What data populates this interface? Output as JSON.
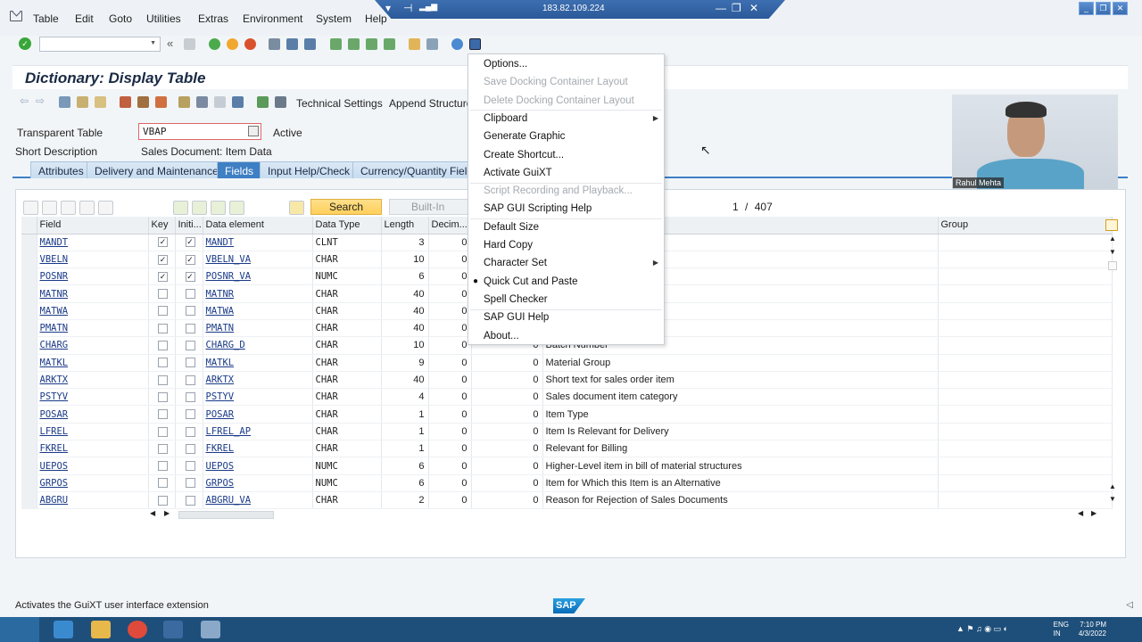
{
  "menubar": {
    "items": [
      "Table",
      "Edit",
      "Goto",
      "Utilities",
      "Extras",
      "Environment",
      "System",
      "Help"
    ],
    "remote_ip": "183.82.109.224"
  },
  "title": "Dictionary: Display Table",
  "app_toolbar": {
    "technical_settings": "Technical Settings",
    "append_structure": "Append Structure"
  },
  "header": {
    "transparent_table_label": "Transparent Table",
    "table_name": "VBAP",
    "status": "Active",
    "short_desc_label": "Short Description",
    "short_desc_value": "Sales Document: Item Data"
  },
  "tabs": [
    "Attributes",
    "Delivery and Maintenance",
    "Fields",
    "Input Help/Check",
    "Currency/Quantity Fields"
  ],
  "grid": {
    "search_label": "Search",
    "builtin_label": "Built-In Type",
    "page_current": "1",
    "page_sep": "/",
    "page_total": "407",
    "columns": [
      "Field",
      "Key",
      "Initi...",
      "Data element",
      "Data Type",
      "Length",
      "Decim...",
      "",
      "",
      "Group"
    ],
    "rows": [
      {
        "field": "MANDT",
        "key": true,
        "init": true,
        "elem": "MANDT",
        "type": "CLNT",
        "len": "3",
        "dec": "0",
        "coord": "",
        "desc": ""
      },
      {
        "field": "VBELN",
        "key": true,
        "init": true,
        "elem": "VBELN_VA",
        "type": "CHAR",
        "len": "10",
        "dec": "0",
        "coord": "",
        "desc": ""
      },
      {
        "field": "POSNR",
        "key": true,
        "init": true,
        "elem": "POSNR_VA",
        "type": "NUMC",
        "len": "6",
        "dec": "0",
        "coord": "",
        "desc": ""
      },
      {
        "field": "MATNR",
        "key": false,
        "init": false,
        "elem": "MATNR",
        "type": "CHAR",
        "len": "40",
        "dec": "0",
        "coord": "",
        "desc": ""
      },
      {
        "field": "MATWA",
        "key": false,
        "init": false,
        "elem": "MATWA",
        "type": "CHAR",
        "len": "40",
        "dec": "0",
        "coord": "",
        "desc": ""
      },
      {
        "field": "PMATN",
        "key": false,
        "init": false,
        "elem": "PMATN",
        "type": "CHAR",
        "len": "40",
        "dec": "0",
        "coord": "",
        "desc": ""
      },
      {
        "field": "CHARG",
        "key": false,
        "init": false,
        "elem": "CHARG_D",
        "type": "CHAR",
        "len": "10",
        "dec": "0",
        "coord": "0",
        "desc": "Batch Number"
      },
      {
        "field": "MATKL",
        "key": false,
        "init": false,
        "elem": "MATKL",
        "type": "CHAR",
        "len": "9",
        "dec": "0",
        "coord": "0",
        "desc": "Material Group"
      },
      {
        "field": "ARKTX",
        "key": false,
        "init": false,
        "elem": "ARKTX",
        "type": "CHAR",
        "len": "40",
        "dec": "0",
        "coord": "0",
        "desc": "Short text for sales order item"
      },
      {
        "field": "PSTYV",
        "key": false,
        "init": false,
        "elem": "PSTYV",
        "type": "CHAR",
        "len": "4",
        "dec": "0",
        "coord": "0",
        "desc": "Sales document item category"
      },
      {
        "field": "POSAR",
        "key": false,
        "init": false,
        "elem": "POSAR",
        "type": "CHAR",
        "len": "1",
        "dec": "0",
        "coord": "0",
        "desc": "Item Type"
      },
      {
        "field": "LFREL",
        "key": false,
        "init": false,
        "elem": "LFREL_AP",
        "type": "CHAR",
        "len": "1",
        "dec": "0",
        "coord": "0",
        "desc": "Item Is Relevant for Delivery"
      },
      {
        "field": "FKREL",
        "key": false,
        "init": false,
        "elem": "FKREL",
        "type": "CHAR",
        "len": "1",
        "dec": "0",
        "coord": "0",
        "desc": "Relevant for Billing"
      },
      {
        "field": "UEPOS",
        "key": false,
        "init": false,
        "elem": "UEPOS",
        "type": "NUMC",
        "len": "6",
        "dec": "0",
        "coord": "0",
        "desc": "Higher-Level item in bill of material structures"
      },
      {
        "field": "GRPOS",
        "key": false,
        "init": false,
        "elem": "GRPOS",
        "type": "NUMC",
        "len": "6",
        "dec": "0",
        "coord": "0",
        "desc": "Item for Which this Item is an Alternative"
      },
      {
        "field": "ABGRU",
        "key": false,
        "init": false,
        "elem": "ABGRU_VA",
        "type": "CHAR",
        "len": "2",
        "dec": "0",
        "coord": "0",
        "desc": "Reason for Rejection of Sales Documents"
      }
    ]
  },
  "context_menu": {
    "items": [
      {
        "label": "Options...",
        "disabled": false,
        "submenu": false,
        "bullet": false
      },
      {
        "label": "Save Docking Container Layout",
        "disabled": true,
        "submenu": false,
        "bullet": false
      },
      {
        "label": "Delete Docking Container Layout",
        "disabled": true,
        "submenu": false,
        "bullet": false
      },
      {
        "label": "Clipboard",
        "disabled": false,
        "submenu": true,
        "bullet": false
      },
      {
        "label": "Generate Graphic",
        "disabled": false,
        "submenu": false,
        "bullet": false
      },
      {
        "label": "Create Shortcut...",
        "disabled": false,
        "submenu": false,
        "bullet": false
      },
      {
        "label": "Activate GuiXT",
        "disabled": false,
        "submenu": false,
        "bullet": false
      },
      {
        "label": "Script Recording and Playback...",
        "disabled": true,
        "submenu": false,
        "bullet": false
      },
      {
        "label": "SAP GUI Scripting Help",
        "disabled": false,
        "submenu": false,
        "bullet": false
      },
      {
        "label": "Default Size",
        "disabled": false,
        "submenu": false,
        "bullet": false
      },
      {
        "label": "Hard Copy",
        "disabled": false,
        "submenu": false,
        "bullet": false
      },
      {
        "label": "Character Set",
        "disabled": false,
        "submenu": true,
        "bullet": false
      },
      {
        "label": "Quick Cut and Paste",
        "disabled": false,
        "submenu": false,
        "bullet": true
      },
      {
        "label": "Spell Checker",
        "disabled": false,
        "submenu": false,
        "bullet": false
      },
      {
        "label": "SAP GUI Help",
        "disabled": false,
        "submenu": false,
        "bullet": false
      },
      {
        "label": "About...",
        "disabled": false,
        "submenu": false,
        "bullet": false
      }
    ]
  },
  "webcam": {
    "name": "Rahul Mehta"
  },
  "status": {
    "message": "Activates the GuiXT user interface extension",
    "logo": "SAP"
  },
  "taskbar": {
    "lang_1": "ENG",
    "lang_2": "IN",
    "time": "7:10 PM",
    "date": "4/3/2022"
  },
  "colors": {
    "accent": "#3f7fc4",
    "search_button": "#ffd05a",
    "ok_icon": "#3aa63a",
    "taskbar": "#1e4f7a"
  }
}
